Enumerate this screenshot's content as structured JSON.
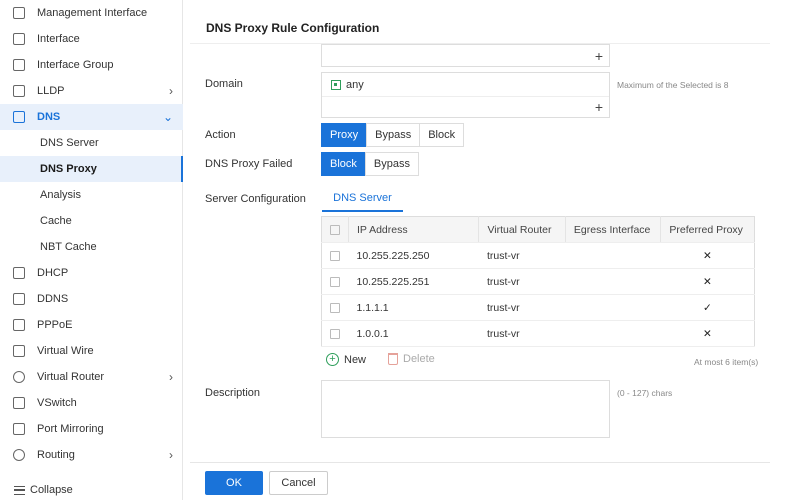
{
  "sidebar": {
    "items": [
      {
        "label": "Management Interface",
        "icon": "monitor-icon"
      },
      {
        "label": "Interface",
        "icon": "interface-icon"
      },
      {
        "label": "Interface Group",
        "icon": "interface-group-icon"
      },
      {
        "label": "LLDP",
        "icon": "lldp-icon"
      },
      {
        "label": "DNS",
        "icon": "dns-icon"
      },
      {
        "label": "DNS Server"
      },
      {
        "label": "DNS Proxy"
      },
      {
        "label": "Analysis"
      },
      {
        "label": "Cache"
      },
      {
        "label": "NBT Cache"
      },
      {
        "label": "DHCP",
        "icon": "dhcp-icon"
      },
      {
        "label": "DDNS",
        "icon": "ddns-icon"
      },
      {
        "label": "PPPoE",
        "icon": "pppoe-icon"
      },
      {
        "label": "Virtual Wire",
        "icon": "virtual-wire-icon"
      },
      {
        "label": "Virtual Router",
        "icon": "virtual-router-icon"
      },
      {
        "label": "VSwitch",
        "icon": "vswitch-icon"
      },
      {
        "label": "Port Mirroring",
        "icon": "port-mirroring-icon"
      },
      {
        "label": "Routing",
        "icon": "routing-icon"
      }
    ],
    "chevron_right": "›",
    "chevron_down": "⌄",
    "collapse_label": "Collapse"
  },
  "page": {
    "title": "DNS Proxy Rule Configuration",
    "plus": "+",
    "domain_label": "Domain",
    "domain_value": "any",
    "domain_hint": "Maximum of the Selected is 8",
    "action_label": "Action",
    "action_options": [
      "Proxy",
      "Bypass",
      "Block"
    ],
    "action_selected": "Proxy",
    "failed_label": "DNS Proxy Failed",
    "failed_options": [
      "Block",
      "Bypass"
    ],
    "failed_selected": "Block",
    "server_label": "Server Configuration",
    "server_tab": "DNS Server",
    "table_headers": [
      "IP Address",
      "Virtual Router",
      "Egress Interface",
      "Preferred Proxy"
    ],
    "table_rows": [
      {
        "ip": "10.255.225.250",
        "vr": "trust-vr",
        "egress": "",
        "preferred": "✕"
      },
      {
        "ip": "10.255.225.251",
        "vr": "trust-vr",
        "egress": "",
        "preferred": "✕"
      },
      {
        "ip": "1.1.1.1",
        "vr": "trust-vr",
        "egress": "",
        "preferred": "✓"
      },
      {
        "ip": "1.0.0.1",
        "vr": "trust-vr",
        "egress": "",
        "preferred": "✕"
      }
    ],
    "new_label": "New",
    "delete_label": "Delete",
    "table_hint": "At most 6 item(s)",
    "description_label": "Description",
    "description_value": "",
    "description_hint": "(0 - 127) chars",
    "ok_label": "OK",
    "cancel_label": "Cancel"
  },
  "colors": {
    "accent": "#1a73d9",
    "add": "#2e9e5b",
    "delete": "#e5a29a"
  }
}
